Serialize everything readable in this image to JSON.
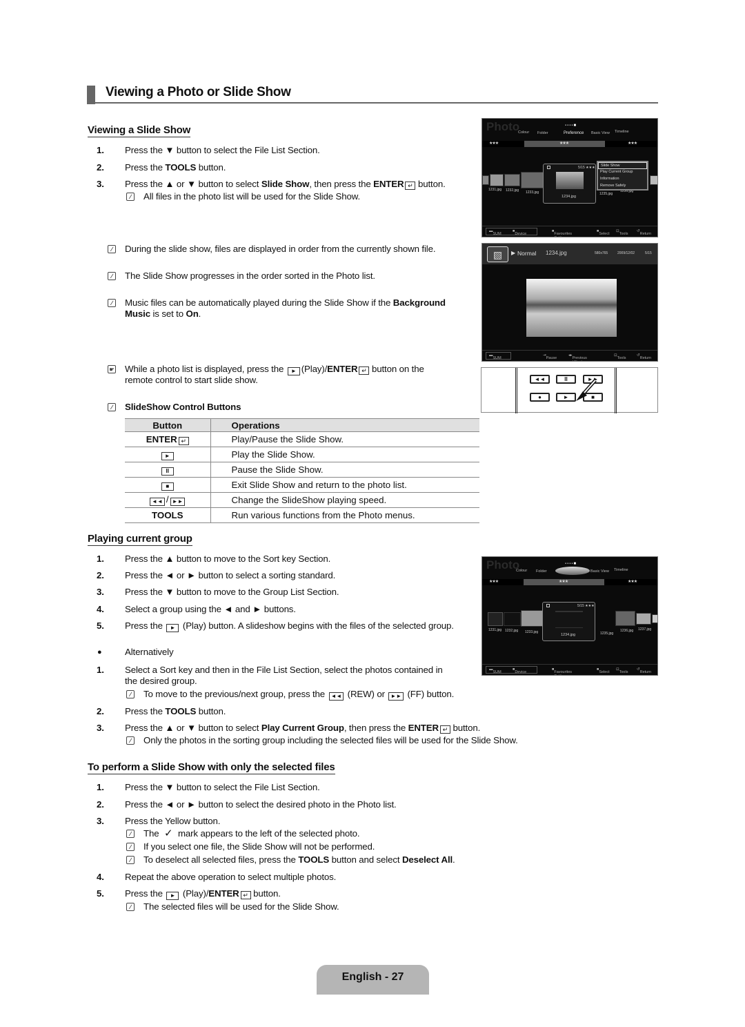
{
  "page_title": "Viewing a Photo or Slide Show",
  "section1": {
    "heading": "Viewing a Slide Show",
    "steps": [
      {
        "n": "1.",
        "pre": "Press the ▼ button to select the File List Section."
      },
      {
        "n": "2.",
        "pre": "Press the ",
        "bold": "TOOLS",
        "post": " button."
      },
      {
        "n": "3.",
        "pre": "Press the ▲ or ▼ button to select ",
        "bold": "Slide Show",
        "mid": ", then press the ",
        "bold2": "ENTER",
        "post": " button."
      }
    ],
    "step3_note": "All files in the photo list will be used for the Slide Show.",
    "notes": [
      "During the slide show, files are displayed in order from the currently shown file.",
      "The Slide Show progresses in the order sorted in the Photo list."
    ],
    "music_note": {
      "pre": "Music files can be automatically played during the Slide Show if the ",
      "bold1": "Background",
      "bold2": "Music",
      "mid": " is set to ",
      "bold3": "On",
      "post": "."
    },
    "remote_note": {
      "pre": "While a photo list is displayed, press the ",
      "mid": "(Play)/",
      "bold": "ENTER",
      "post": " button on the",
      "line2": "remote control to start slide show."
    },
    "control_title": "SlideShow Control Buttons",
    "table": {
      "headers": [
        "Button",
        "Operations"
      ],
      "rows": [
        {
          "button": "ENTER",
          "button_icon": "enter-icon",
          "op": "Play/Pause the Slide Show."
        },
        {
          "button": "►",
          "button_icon": "play-icon",
          "op": "Play the Slide Show."
        },
        {
          "button": "II",
          "button_icon": "pause-icon",
          "op": "Pause the Slide Show."
        },
        {
          "button": "■",
          "button_icon": "stop-icon",
          "op": "Exit Slide Show and return to the photo list."
        },
        {
          "button": "◄◄/►►",
          "button_icon": "rew-ff-icon",
          "op": "Change the SlideShow playing speed."
        },
        {
          "button": "TOOLS",
          "button_icon": "",
          "op": "Run various functions from the Photo menus."
        }
      ]
    }
  },
  "section2": {
    "heading": "Playing current group",
    "steps": [
      {
        "n": "1.",
        "text": "Press the ▲ button to move to the Sort key Section."
      },
      {
        "n": "2.",
        "text": "Press the ◄ or ► button to select a sorting standard."
      },
      {
        "n": "3.",
        "text": "Press the ▼ button to move to the Group List Section."
      },
      {
        "n": "4.",
        "text": "Select a group using the ◄ and ► buttons."
      },
      {
        "n": "5.",
        "pre": "Press the ",
        "post": " (Play) button. A slideshow begins with the files of the selected group."
      }
    ],
    "alt_label": "Alternatively",
    "alt_steps": [
      {
        "n": "1.",
        "text": "Select a Sort key and then in the File List Section, select the photos contained in",
        "line2": "the desired group."
      },
      {
        "n": "2.",
        "pre": "Press the ",
        "bold": "TOOLS",
        "post": " button."
      },
      {
        "n": "3.",
        "pre": "Press the ▲ or ▼ button to select ",
        "bold": "Play Current Group",
        "mid": ", then press the ",
        "bold2": "ENTER",
        "post": " button."
      }
    ],
    "alt1_note": {
      "pre": "To move to the previous/next group, press the ",
      "mid": " (REW) or ",
      "post": " (FF) button."
    },
    "alt3_note": "Only the photos in the sorting group including the selected files will be used for the Slide Show."
  },
  "section3": {
    "heading": "To perform a Slide Show with only the selected files",
    "steps": [
      {
        "n": "1.",
        "text": "Press the ▼ button to select the File List Section."
      },
      {
        "n": "2.",
        "text": "Press the ◄ or ► button to select the desired photo in the Photo list."
      },
      {
        "n": "3.",
        "text": "Press the Yellow button."
      },
      {
        "n": "4.",
        "text": "Repeat the above operation to select multiple photos."
      },
      {
        "n": "5.",
        "pre": "Press the ",
        "mid": " (Play)/",
        "bold": "ENTER",
        "post": " button."
      }
    ],
    "step3_notes": [
      {
        "pre": "The ",
        "post": " mark appears to the left of the selected photo."
      },
      {
        "text": "If you select one file, the Slide Show will not be performed."
      },
      {
        "pre": "To deselect all selected files, press the ",
        "bold": "TOOLS",
        "mid": " button and select ",
        "bold2": "Deselect All",
        "post": "."
      }
    ],
    "step5_note": "The selected files will be used for the Slide Show."
  },
  "tv1": {
    "logo": "Photo",
    "sort_keys": [
      "Colour",
      "Folder",
      "Preference",
      "Basic View",
      "Timeline"
    ],
    "stars": "★★★",
    "files": [
      "1231.jpg",
      "1232.jpg",
      "1233.jpg",
      "1234.jpg",
      "1235.jpg",
      "1236.jpg"
    ],
    "counter": "5/15",
    "menu": [
      "Slide Show",
      "Play Current Group",
      "Information",
      "Remove Safely"
    ],
    "footer": {
      "sum": "SUM",
      "device": "Device",
      "fav": "Favourites Settings",
      "select": "Select",
      "tools": "Tools",
      "return": "Return"
    }
  },
  "tv2": {
    "mode": "Normal",
    "file": "1234.jpg",
    "resolution": "580x765",
    "date": "2009/12/02",
    "counter": "5/15",
    "footer": {
      "sum": "SUM",
      "pause": "Pause",
      "prevnext": "Previous / Next",
      "tools": "Tools",
      "return": "Return"
    }
  },
  "remote": {
    "buttons_top": [
      "◄◄",
      "II",
      "►►"
    ],
    "buttons_bottom": [
      "●",
      "►",
      "■"
    ]
  },
  "tv3": {
    "logo": "Photo",
    "sort_keys": [
      "Colour",
      "Folder",
      "Basic View",
      "Timeline"
    ],
    "stars": "★★★",
    "files": [
      "1231.jpg",
      "1232.jpg",
      "1233.jpg",
      "1234.jpg",
      "1235.jpg",
      "1236.jpg",
      "1237.jpg"
    ],
    "counter": "5/15",
    "footer": {
      "sum": "SUM",
      "device": "Device",
      "fav": "Favourites Settings",
      "select": "Select",
      "tools": "Tools",
      "return": "Return"
    }
  },
  "page_footer": "English - 27"
}
